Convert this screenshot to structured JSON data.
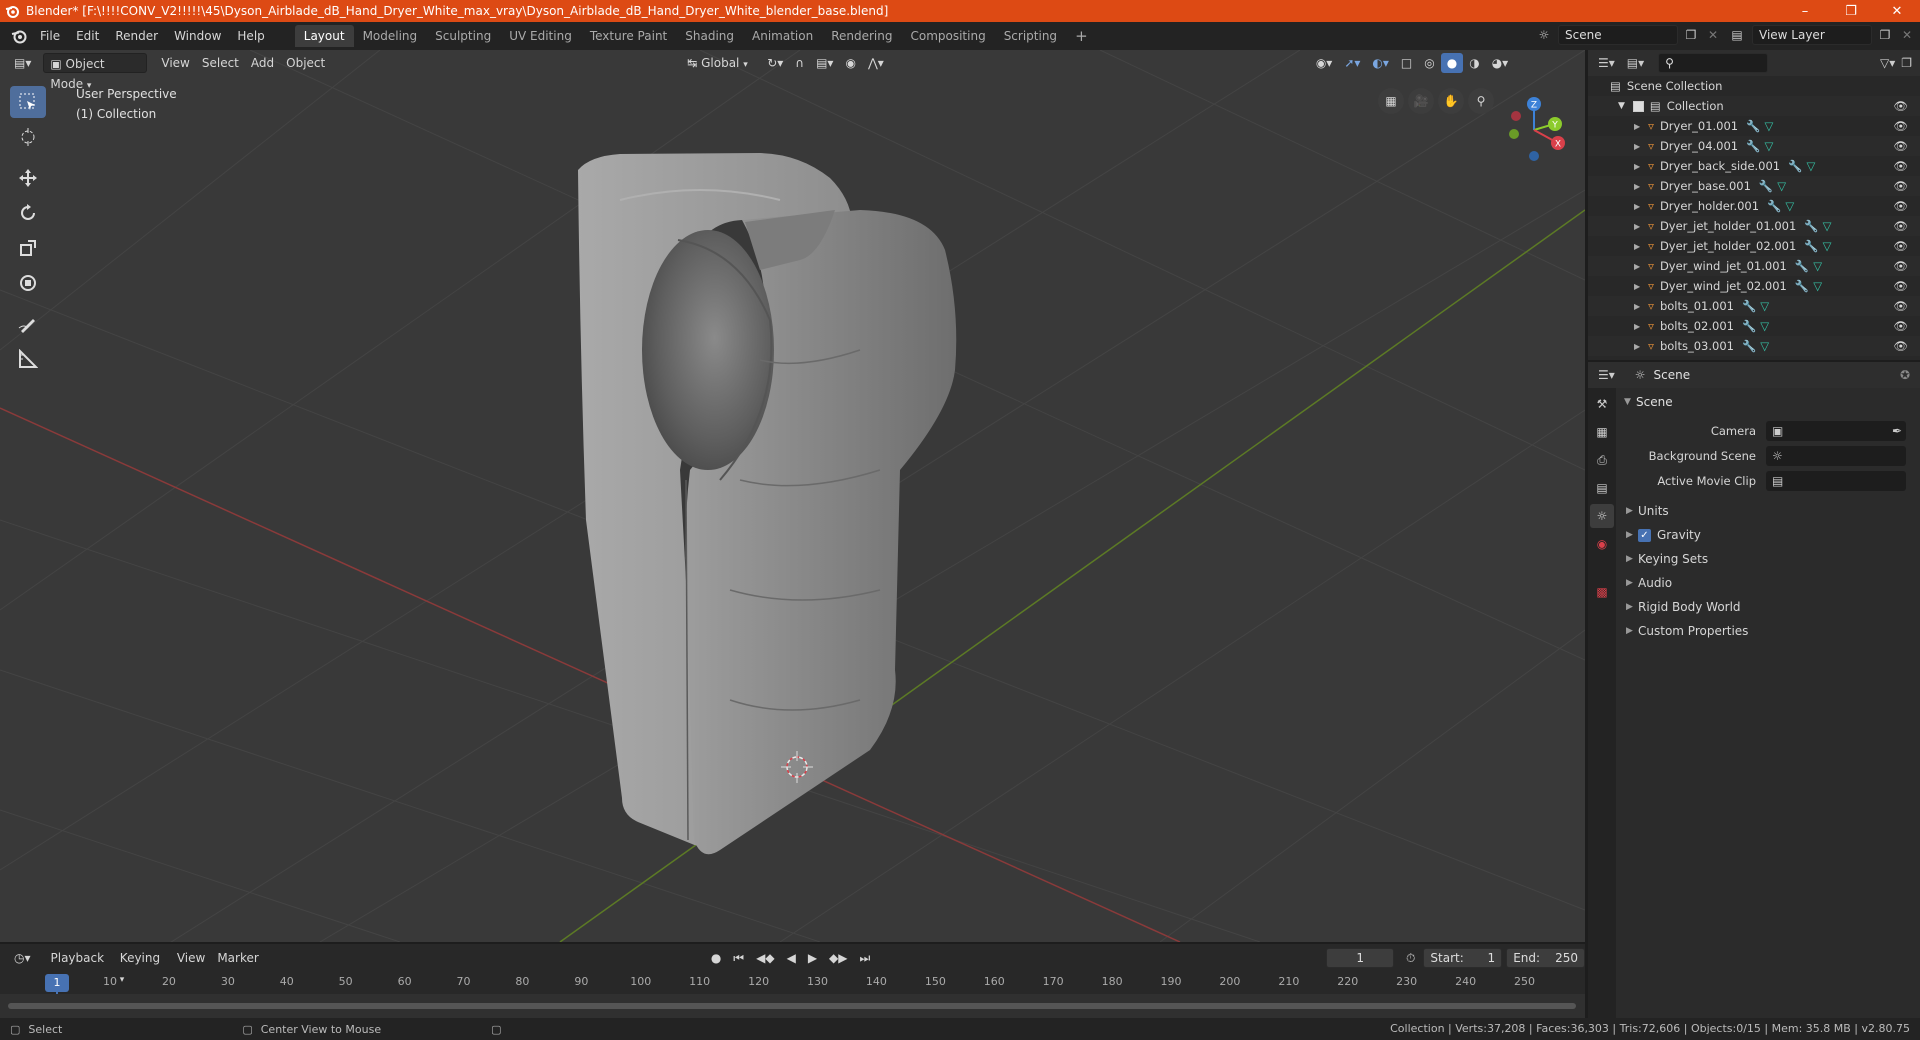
{
  "window": {
    "title": "Blender* [F:\\!!!!CONV_V2!!!!!\\45\\Dyson_Airblade_dB_Hand_Dryer_White_max_vray\\Dyson_Airblade_dB_Hand_Dryer_White_blender_base.blend]"
  },
  "menu": [
    "File",
    "Edit",
    "Render",
    "Window",
    "Help"
  ],
  "workspaces": [
    "Layout",
    "Modeling",
    "Sculpting",
    "UV Editing",
    "Texture Paint",
    "Shading",
    "Animation",
    "Rendering",
    "Compositing",
    "Scripting"
  ],
  "workspace_active": "Layout",
  "top_right": {
    "scene": "Scene",
    "view_layer": "View Layer"
  },
  "viewport": {
    "mode": "Object Mode",
    "menus": [
      "View",
      "Select",
      "Add",
      "Object"
    ],
    "transform": "Global",
    "perspective": "User Perspective",
    "collection": "(1) Collection",
    "axes": {
      "z": "Z",
      "y": "Y",
      "x": "X"
    }
  },
  "outliner": {
    "root": "Scene Collection",
    "collection": "Collection",
    "items": [
      "Dryer_01.001",
      "Dryer_04.001",
      "Dryer_back_side.001",
      "Dryer_base.001",
      "Dryer_holder.001",
      "Dyer_jet_holder_01.001",
      "Dyer_jet_holder_02.001",
      "Dyer_wind_jet_01.001",
      "Dyer_wind_jet_02.001",
      "bolts_01.001",
      "bolts_02.001",
      "bolts_03.001"
    ]
  },
  "properties": {
    "context": "Scene",
    "panel": "Scene",
    "fields": [
      {
        "label": "Camera"
      },
      {
        "label": "Background Scene"
      },
      {
        "label": "Active Movie Clip"
      }
    ],
    "subpanels": [
      "Units",
      "Gravity",
      "Keying Sets",
      "Audio",
      "Rigid Body World",
      "Custom Properties"
    ]
  },
  "timeline": {
    "menus": [
      "Playback",
      "Keying",
      "View",
      "Marker"
    ],
    "current_frame": "1",
    "start_label": "Start:",
    "start": "1",
    "end_label": "End:",
    "end": "250",
    "ruler": [
      "1",
      "10",
      "20",
      "30",
      "40",
      "50",
      "60",
      "70",
      "80",
      "90",
      "100",
      "110",
      "120",
      "130",
      "140",
      "150",
      "160",
      "170",
      "180",
      "190",
      "200",
      "210",
      "220",
      "230",
      "240",
      "250"
    ]
  },
  "status": {
    "left_action": "Select",
    "mid_action": "Center View to Mouse",
    "stats": "Collection | Verts:37,208 | Faces:36,303 | Tris:72,606 | Objects:0/15 | Mem: 35.8 MB | v2.80.75"
  },
  "colors": {
    "title_bar": "#dd4a14",
    "accent": "#4772b3",
    "x_axis": "#d9404a",
    "y_axis": "#8ccb2c",
    "z_axis": "#3d82d8"
  }
}
